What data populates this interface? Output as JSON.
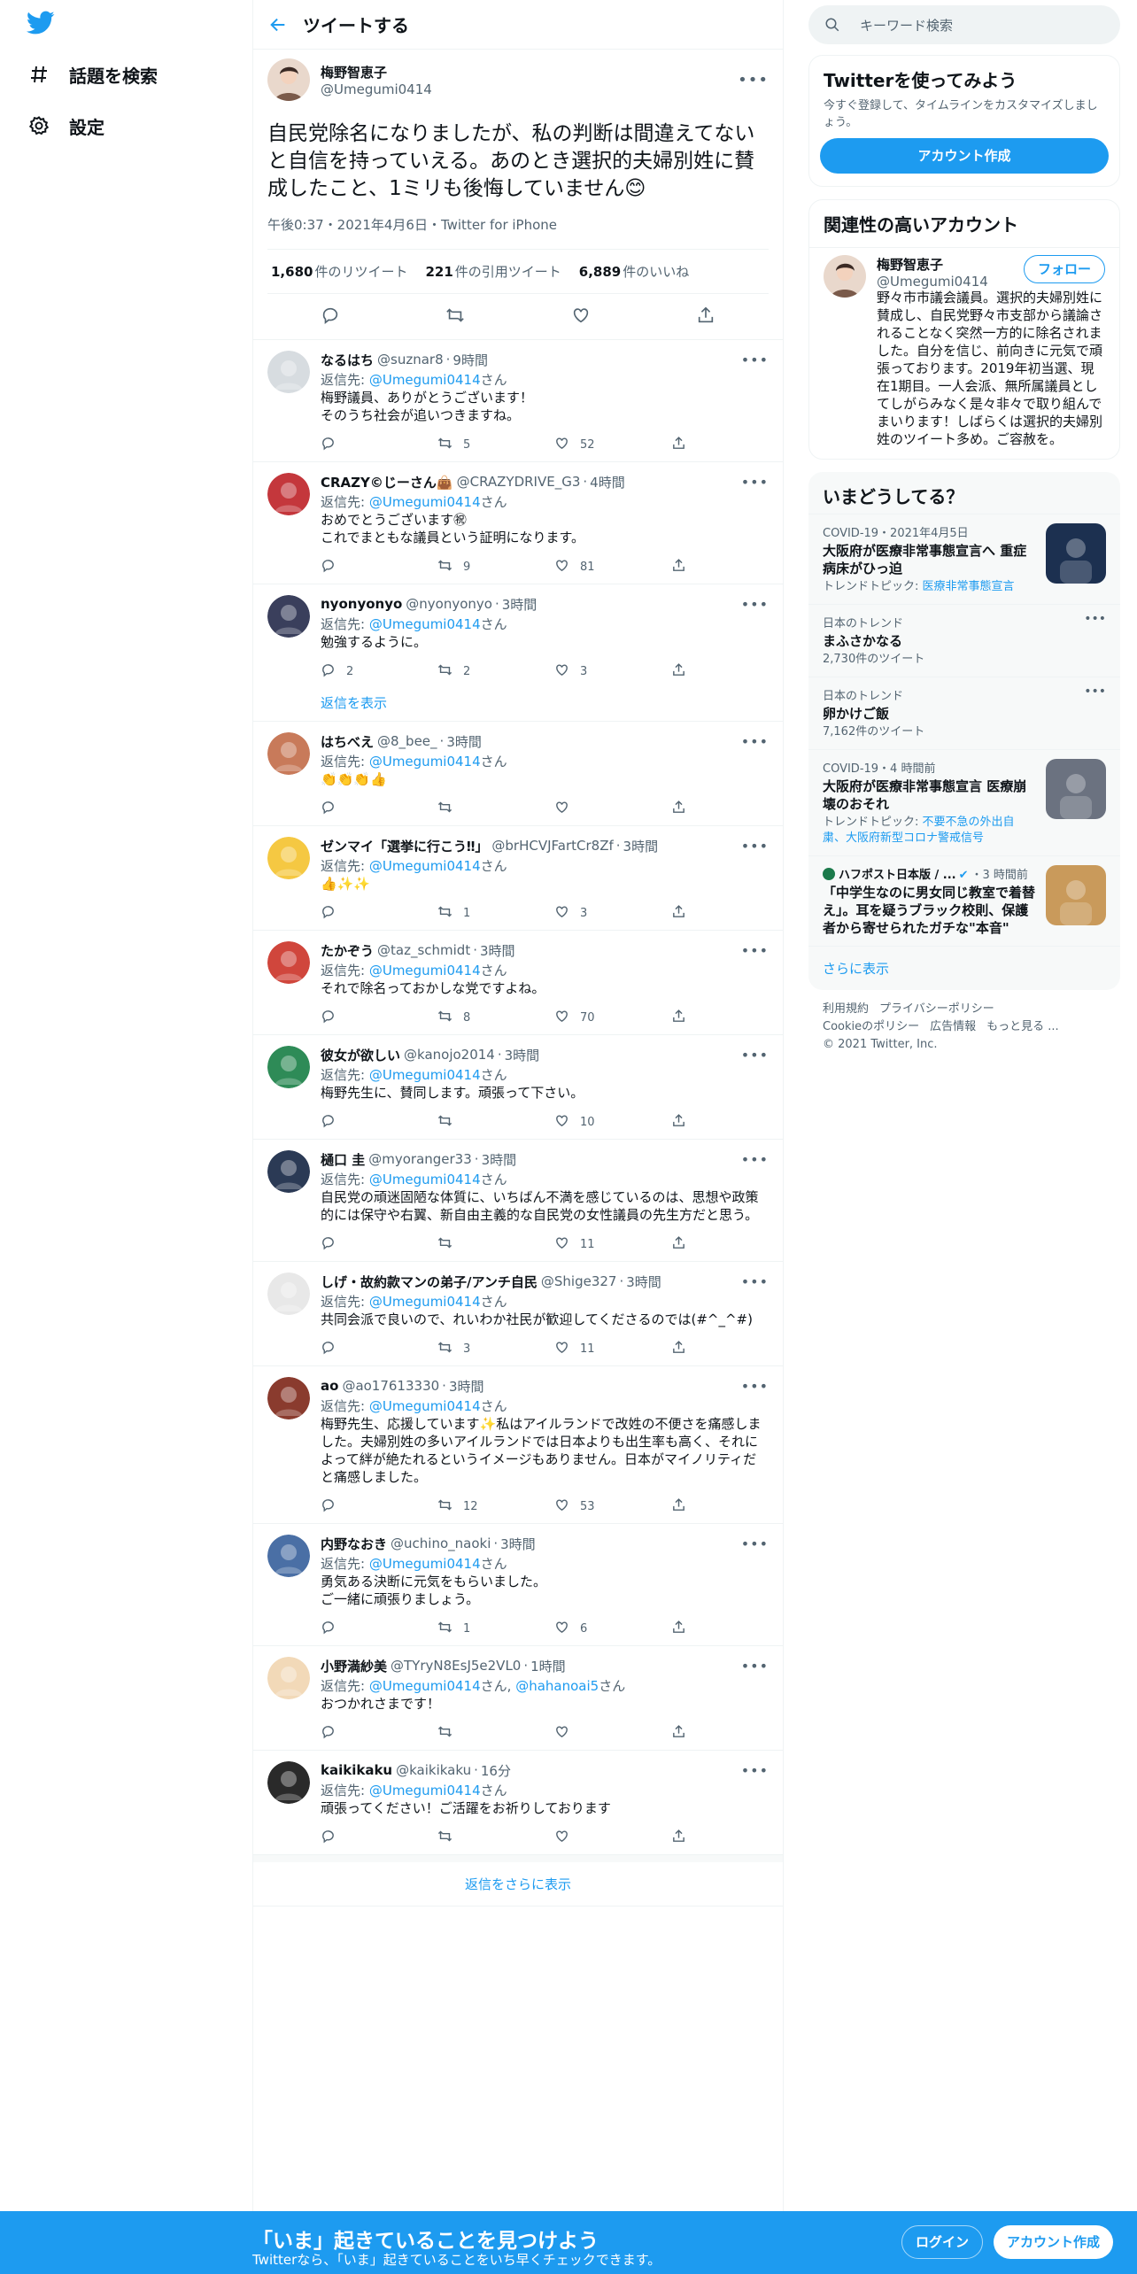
{
  "sidebar": {
    "explore_label": "話題を検索",
    "settings_label": "設定"
  },
  "header": {
    "title": "ツイートする"
  },
  "tweet": {
    "name": "梅野智恵子",
    "handle": "@Umegumi0414",
    "text": "自民党除名になりましたが、私の判断は間違えてないと自信を持っていえる。あのとき選択的夫婦別姓に賛成したこと、1ミリも後悔していません😊",
    "meta": "午後0:37・2021年4月6日・Twitter for iPhone",
    "retweets": "1,680",
    "retweets_label": "件のリツイート",
    "quotes": "221",
    "quotes_label": "件の引用ツイート",
    "likes": "6,889",
    "likes_label": "件のいいね"
  },
  "replying_label": "返信先:",
  "san": "さん",
  "replies": [
    {
      "name": "なるはち",
      "handle": "@suznar8",
      "time": "9時間",
      "to": "@Umegumi0414",
      "text": "梅野議員、ありがとうございます！\nそのうち社会が追いつきますね。",
      "rt": "5",
      "like": "52",
      "color": "#d7dce0"
    },
    {
      "name": "CRAZY©じーさん👜",
      "handle": "@CRAZYDRIVE_G3",
      "time": "4時間",
      "to": "@Umegumi0414",
      "text": "おめでとうございます㊗\nこれでまともな議員という証明になります。",
      "rt": "9",
      "like": "81",
      "color": "#c4373c"
    },
    {
      "name": "nyonyonyo",
      "handle": "@nyonyonyo",
      "time": "3時間",
      "to": "@Umegumi0414",
      "text": "勉強するように。",
      "reply": "2",
      "rt": "2",
      "like": "3",
      "color": "#3a3f5c"
    },
    {
      "name": "はちべえ",
      "handle": "@8_bee_",
      "time": "3時間",
      "to": "@Umegumi0414",
      "text": "👏👏👏👍",
      "color": "#c87a5a"
    },
    {
      "name": "ゼンマイ「選挙に行こう‼」",
      "handle": "@brHCVJFartCr8Zf",
      "time": "3時間",
      "to": "@Umegumi0414",
      "text": "👍✨✨",
      "rt": "1",
      "like": "3",
      "color": "#f5c842"
    },
    {
      "name": "たかぞう",
      "handle": "@taz_schmidt",
      "time": "3時間",
      "to": "@Umegumi0414",
      "text": "それで除名っておかしな党ですよね。",
      "rt": "8",
      "like": "70",
      "color": "#d0463c"
    },
    {
      "name": "彼女が欲しい",
      "handle": "@kanojo2014",
      "time": "3時間",
      "to": "@Umegumi0414",
      "text": "梅野先生に、賛同します。頑張って下さい。",
      "like": "10",
      "color": "#2e8b57"
    },
    {
      "name": "樋口 圭",
      "handle": "@myoranger33",
      "time": "3時間",
      "to": "@Umegumi0414",
      "text": "自民党の頑迷固陋な体質に、いちばん不満を感じているのは、思想や政策的には保守や右翼、新自由主義的な自民党の女性議員の先生方だと思う。",
      "like": "11",
      "color": "#2b3a55"
    },
    {
      "name": "しげ・故約款マンの弟子/アンチ自民",
      "handle": "@Shige327",
      "time": "3時間",
      "to": "@Umegumi0414",
      "text": "共同会派で良いので、れいわか社民が歓迎してくださるのでは(#^_^#)",
      "rt": "3",
      "like": "11",
      "color": "#e8e8e8"
    },
    {
      "name": "ao",
      "handle": "@ao17613330",
      "time": "3時間",
      "to": "@Umegumi0414",
      "text": "梅野先生、応援しています✨私はアイルランドで改姓の不便さを痛感しました。夫婦別姓の多いアイルランドでは日本よりも出生率も高く、それによって絆が絶たれるというイメージもありません。日本がマイノリティだと痛感しました。",
      "rt": "12",
      "like": "53",
      "color": "#8a3b2e"
    },
    {
      "name": "内野なおき",
      "handle": "@uchino_naoki",
      "time": "3時間",
      "to": "@Umegumi0414",
      "text": "勇気ある決断に元気をもらいました。\nご一緒に頑張りましょう。",
      "rt": "1",
      "like": "6",
      "color": "#4a6fa5"
    },
    {
      "name": "小野満紗美",
      "handle": "@TYryN8EsJ5e2VL0",
      "time": "1時間",
      "to": "@Umegumi0414",
      "to2": "@hahanoai5",
      "text": "おつかれさまです！",
      "color": "#f2d9b8"
    },
    {
      "name": "kaikikaku",
      "handle": "@kaikikaku",
      "time": "16分",
      "to": "@Umegumi0414",
      "text": "頑張ってください！ご活躍をお祈りしております",
      "color": "#2a2a2a"
    }
  ],
  "show_replies": "返信を表示",
  "more_replies": "返信をさらに表示",
  "right": {
    "search_placeholder": "キーワード検索",
    "join_title": "Twitterを使ってみよう",
    "join_sub": "今すぐ登録して、タイムラインをカスタマイズしましょう。",
    "join_button": "アカウント作成",
    "related_title": "関連性の高いアカウント",
    "related_name": "梅野智恵子",
    "related_handle": "@Umegumi0414",
    "follow": "フォロー",
    "related_bio": "野々市市議会議員。選択的夫婦別姓に賛成し、自民党野々市支部から議論されることなく突然一方的に除名されました。自分を信じ、前向きに元気で頑張っております。2019年初当選、現在1期目。一人会派、無所属議員としてしがらみなく是々非々で取り組んでまいります！しばらくは選択的夫婦別姓のツイート多め。ご容赦を。",
    "trends_title": "いまどうしてる？",
    "trends": [
      {
        "ctx": "COVID-19・2021年4月5日",
        "title": "大阪府が医療非常事態宣言へ 重症病床がひっ迫",
        "sub_label": "トレンドトピック:",
        "sub_link": "医療非常事態宣言",
        "img": "#1c3050"
      },
      {
        "ctx": "日本のトレンド",
        "title": "まふさかなる",
        "sub": "2,730件のツイート"
      },
      {
        "ctx": "日本のトレンド",
        "title": "卵かけご飯",
        "sub": "7,162件のツイート"
      },
      {
        "ctx": "COVID-19・4 時間前",
        "title": "大阪府が医療非常事態宣言 医療崩壊のおそれ",
        "sub_label": "トレンドトピック:",
        "sub_link": "不要不急の外出自粛、大阪府新型コロナ警戒信号",
        "img": "#6b7280"
      },
      {
        "ctx_src": "ハフポスト日本版 / ...",
        "ctx": "・3 時間前",
        "title": "「中学生なのに男女同じ教室で着替え」。耳を疑うブラック校則、保護者から寄せられたガチな\"本音\"",
        "img": "#c99a5b"
      }
    ],
    "show_more": "さらに表示",
    "footer": [
      "利用規約",
      "プライバシーポリシー",
      "Cookieのポリシー",
      "広告情報",
      "もっと見る ...",
      "© 2021 Twitter, Inc."
    ]
  },
  "bottom": {
    "title": "「いま」起きていることを見つけよう",
    "sub": "Twitterなら、「いま」起きていることをいち早くチェックできます。",
    "login": "ログイン",
    "signup": "アカウント作成"
  }
}
